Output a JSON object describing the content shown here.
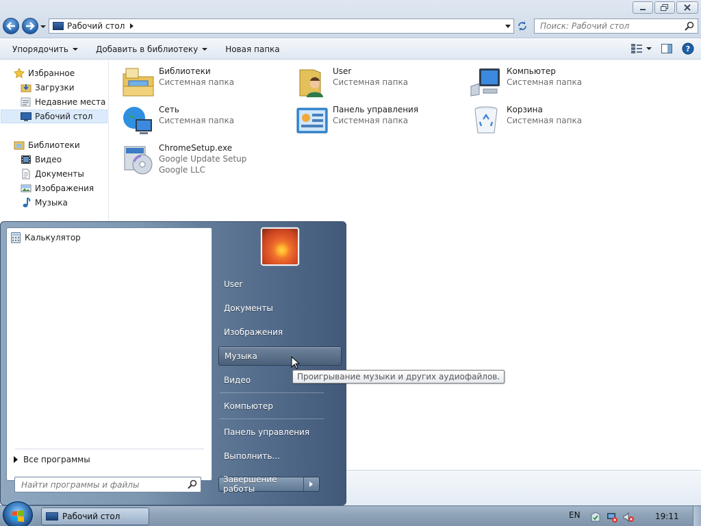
{
  "window": {
    "address_path": "Рабочий стол",
    "search_placeholder": "Поиск: Рабочий стол"
  },
  "toolbar": {
    "organize_label": "Упорядочить",
    "add_to_library_label": "Добавить в библиотеку",
    "new_folder_label": "Новая папка"
  },
  "navpane": {
    "favorites_label": "Избранное",
    "favorites": [
      {
        "label": "Загрузки"
      },
      {
        "label": "Недавние места"
      },
      {
        "label": "Рабочий стол",
        "selected": true
      }
    ],
    "libraries_label": "Библиотеки",
    "libraries": [
      {
        "label": "Видео"
      },
      {
        "label": "Документы"
      },
      {
        "label": "Изображения"
      },
      {
        "label": "Музыка"
      }
    ]
  },
  "files": [
    {
      "name": "Библиотеки",
      "type": "Системная папка",
      "icon": "libraries-icon"
    },
    {
      "name": "User",
      "type": "Системная папка",
      "icon": "user-folder-icon"
    },
    {
      "name": "Компьютер",
      "type": "Системная папка",
      "icon": "computer-icon"
    },
    {
      "name": "Сеть",
      "type": "Системная папка",
      "icon": "network-icon"
    },
    {
      "name": "Панель управления",
      "type": "Системная папка",
      "icon": "control-panel-icon"
    },
    {
      "name": "Корзина",
      "type": "Системная папка",
      "icon": "recycle-bin-icon"
    },
    {
      "name": "ChromeSetup.exe",
      "type": "Google Update Setup",
      "extra": "Google LLC",
      "icon": "installer-icon"
    }
  ],
  "start_menu": {
    "pinned_programs": [
      {
        "label": "Калькулятор",
        "icon": "calculator-icon"
      }
    ],
    "all_programs_label": "Все программы",
    "search_placeholder": "Найти программы и файлы",
    "right_items": [
      {
        "label": "User"
      },
      {
        "label": "Документы"
      },
      {
        "label": "Изображения"
      },
      {
        "label": "Музыка",
        "highlighted": true
      },
      {
        "label": "Видео"
      },
      {
        "label": "Компьютер"
      },
      {
        "label": "Панель управления"
      },
      {
        "label": "Выполнить..."
      }
    ],
    "shutdown_label": "Завершение работы",
    "tooltip": "Проигрывание музыки и других аудиофайлов."
  },
  "taskbar": {
    "task_label": "Рабочий стол",
    "language": "EN",
    "time": "19:11"
  }
}
